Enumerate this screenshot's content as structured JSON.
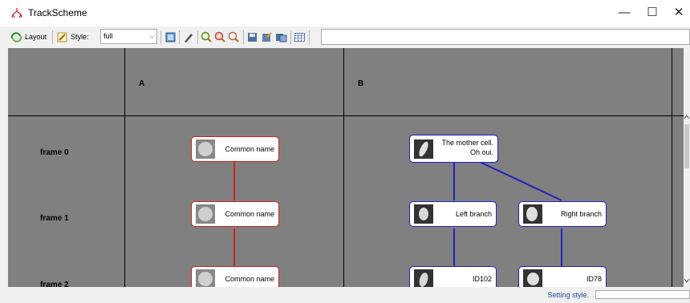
{
  "window": {
    "title": "TrackScheme",
    "controls": {
      "minimize": "—",
      "maximize": "☐",
      "close": "✕"
    }
  },
  "toolbar": {
    "layout_label": "Layout",
    "style_label": "Style:",
    "style_value": "full",
    "icons": [
      "layout-icon",
      "style-icon",
      "capture-overview-icon",
      "paint-icon",
      "zoom-in-icon",
      "zoom-out-icon",
      "zoom-fit-icon",
      "save-icon",
      "export-icon",
      "display-icon",
      "table-icon"
    ]
  },
  "columns": [
    "A",
    "B"
  ],
  "rows": [
    "frame 0",
    "frame 1",
    "frame 2"
  ],
  "nodes": {
    "a0": {
      "label": "Common name"
    },
    "a1": {
      "label": "Common name"
    },
    "a2": {
      "label": "Common name"
    },
    "b0": {
      "line1": "The mother cell.",
      "line2": "Oh oui."
    },
    "b1l": {
      "label": "Left branch"
    },
    "b1r": {
      "label": "Right branch"
    },
    "b2l": {
      "label": "ID102"
    },
    "b2r": {
      "label": "ID78"
    }
  },
  "colors": {
    "track_a": "#d02020",
    "track_b": "#2020c0",
    "canvas_bg": "#808080"
  },
  "status": {
    "text": "Setting style."
  }
}
